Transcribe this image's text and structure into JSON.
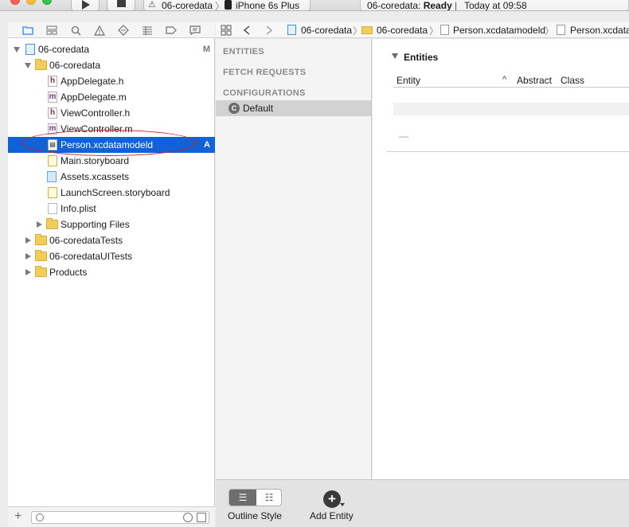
{
  "toolbar": {
    "scheme_target": "06-coredata",
    "scheme_device": "iPhone 6s Plus",
    "activity_name": "06-coredata: ",
    "activity_status": "Ready",
    "activity_separator": "|",
    "activity_time": "Today at 09:58"
  },
  "navigator": {
    "tabs": [
      "folder-icon",
      "symbol-icon",
      "search-icon",
      "warning-icon",
      "test-icon",
      "debug-icon",
      "breakpoint-icon",
      "report-icon"
    ],
    "items": [
      {
        "label": "06-coredata",
        "badge": "M",
        "kind": "project"
      },
      {
        "label": "06-coredata",
        "kind": "folder"
      },
      {
        "label": "AppDelegate.h",
        "kind": "h"
      },
      {
        "label": "AppDelegate.m",
        "kind": "m"
      },
      {
        "label": "ViewController.h",
        "kind": "h"
      },
      {
        "label": "ViewController.m",
        "kind": "m"
      },
      {
        "label": "Person.xcdatamodeld",
        "badge": "A",
        "kind": "model",
        "selected": true
      },
      {
        "label": "Main.storyboard",
        "kind": "storyboard"
      },
      {
        "label": "Assets.xcassets",
        "kind": "xcassets"
      },
      {
        "label": "LaunchScreen.storyboard",
        "kind": "storyboard"
      },
      {
        "label": "Info.plist",
        "kind": "plist"
      },
      {
        "label": "Supporting Files",
        "kind": "folder"
      },
      {
        "label": "06-coredataTests",
        "kind": "folder"
      },
      {
        "label": "06-coredataUITests",
        "kind": "folder"
      },
      {
        "label": "Products",
        "kind": "folder"
      }
    ],
    "file_glyphs": {
      "h": "h",
      "m": "m"
    }
  },
  "jumpbar": {
    "crumbs": [
      "06-coredata",
      "06-coredata",
      "Person.xcdatamodeld",
      "Person.xcdatamod"
    ]
  },
  "outline": {
    "entities_label": "ENTITIES",
    "fetch_requests_label": "FETCH REQUESTS",
    "configurations_label": "CONFIGURATIONS",
    "configuration_icon_glyph": "C",
    "configuration_default": "Default"
  },
  "entities_table": {
    "section_title": "Entities",
    "columns": [
      "Entity",
      "Abstract",
      "Class"
    ],
    "empty_marker": "—"
  },
  "bottombar": {
    "outline_style_label": "Outline Style",
    "add_entity_label": "Add Entity"
  },
  "colors": {
    "selection": "#1062d6",
    "annotation_ellipse": "#cc2222"
  }
}
